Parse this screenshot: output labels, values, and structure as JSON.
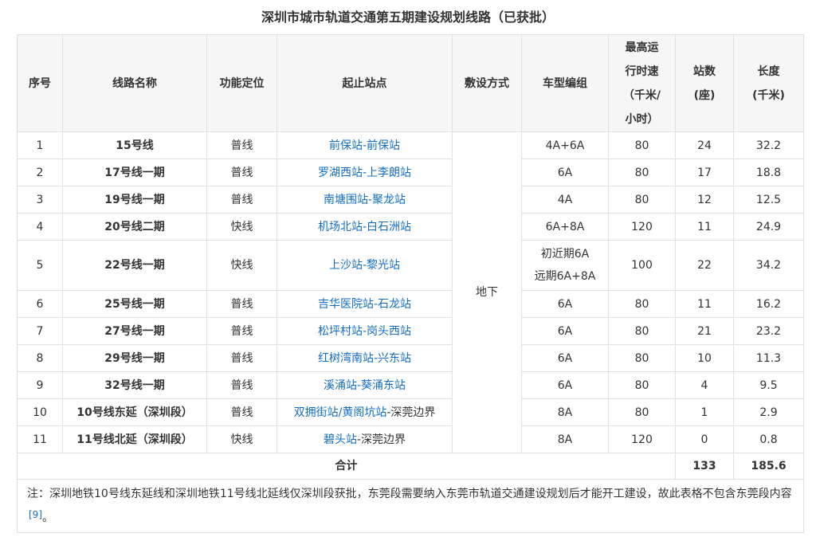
{
  "caption": "深圳市城市轨道交通第五期建设规划线路（已获批）",
  "headers": {
    "seq": "序号",
    "name": "线路名称",
    "function": "功能定位",
    "stations": "起止站点",
    "laying": "敷设方式",
    "train": "车型编组",
    "speed_l1": "最高运",
    "speed_l2": "行时速",
    "speed_l3": "（千米/",
    "speed_l4": "小时）",
    "count_l1": "站数",
    "count_l2": "(座)",
    "length_l1": "长度",
    "length_l2": "(千米)"
  },
  "laying_value": "地下",
  "rows": [
    {
      "seq": "1",
      "name": "15号线",
      "function": "普线",
      "start": "前保站",
      "sep": "-",
      "end": "前保站",
      "train": "4A+6A",
      "speed": "80",
      "count": "24",
      "length": "32.2"
    },
    {
      "seq": "2",
      "name": "17号线一期",
      "function": "普线",
      "start": "罗湖西站",
      "sep": "-",
      "end": "上李朗站",
      "train": "6A",
      "speed": "80",
      "count": "17",
      "length": "18.8"
    },
    {
      "seq": "3",
      "name": "19号线一期",
      "function": "普线",
      "start": "南塘围站",
      "sep": "-",
      "end": "聚龙站",
      "train": "4A",
      "speed": "80",
      "count": "12",
      "length": "12.5"
    },
    {
      "seq": "4",
      "name": "20号线二期",
      "function": "快线",
      "start": "机场北站",
      "sep": "-",
      "end": "白石洲站",
      "train": "6A+8A",
      "speed": "120",
      "count": "11",
      "length": "24.9"
    },
    {
      "seq": "5",
      "name": "22号线一期",
      "function": "快线",
      "start": "上沙站",
      "sep": "-",
      "end": "黎光站",
      "train_l1": "初近期6A",
      "train_l2": "远期6A+8A",
      "speed": "100",
      "count": "22",
      "length": "34.2"
    },
    {
      "seq": "6",
      "name": "25号线一期",
      "function": "普线",
      "start": "吉华医院站",
      "sep": "-",
      "end": "石龙站",
      "train": "6A",
      "speed": "80",
      "count": "11",
      "length": "16.2"
    },
    {
      "seq": "7",
      "name": "27号线一期",
      "function": "普线",
      "start": "松坪村站",
      "sep": "-",
      "end": "岗头西站",
      "train": "6A",
      "speed": "80",
      "count": "21",
      "length": "23.2"
    },
    {
      "seq": "8",
      "name": "29号线一期",
      "function": "普线",
      "start": "红树湾南站",
      "sep": "-",
      "end": "兴东站",
      "train": "6A",
      "speed": "80",
      "count": "10",
      "length": "11.3"
    },
    {
      "seq": "9",
      "name": "32号线一期",
      "function": "普线",
      "start": "溪涌站",
      "sep": "-",
      "end": "葵涌东站",
      "train": "6A",
      "speed": "80",
      "count": "4",
      "length": "9.5"
    },
    {
      "seq": "10",
      "name": "10号线东延（深圳段）",
      "function": "普线",
      "start": "双拥街站",
      "sep": "/",
      "end": "黄阁坑站",
      "tail": "-深莞边界",
      "train": "8A",
      "speed": "80",
      "count": "1",
      "length": "2.9"
    },
    {
      "seq": "11",
      "name": "11号线北延（深圳段）",
      "function": "快线",
      "start": "碧头站",
      "tail": "-深莞边界",
      "train": "8A",
      "speed": "120",
      "count": "0",
      "length": "0.8"
    }
  ],
  "total": {
    "label": "合计",
    "count": "133",
    "length": "185.6"
  },
  "note": {
    "text": "注：深圳地铁10号线东延线和深圳地铁11号线北延线仅深圳段获批，东莞段需要纳入东莞市轨道交通建设规划后才能开工建设，故此表格不包含东莞段内容",
    "ref": "[9]",
    "tail": "。"
  }
}
